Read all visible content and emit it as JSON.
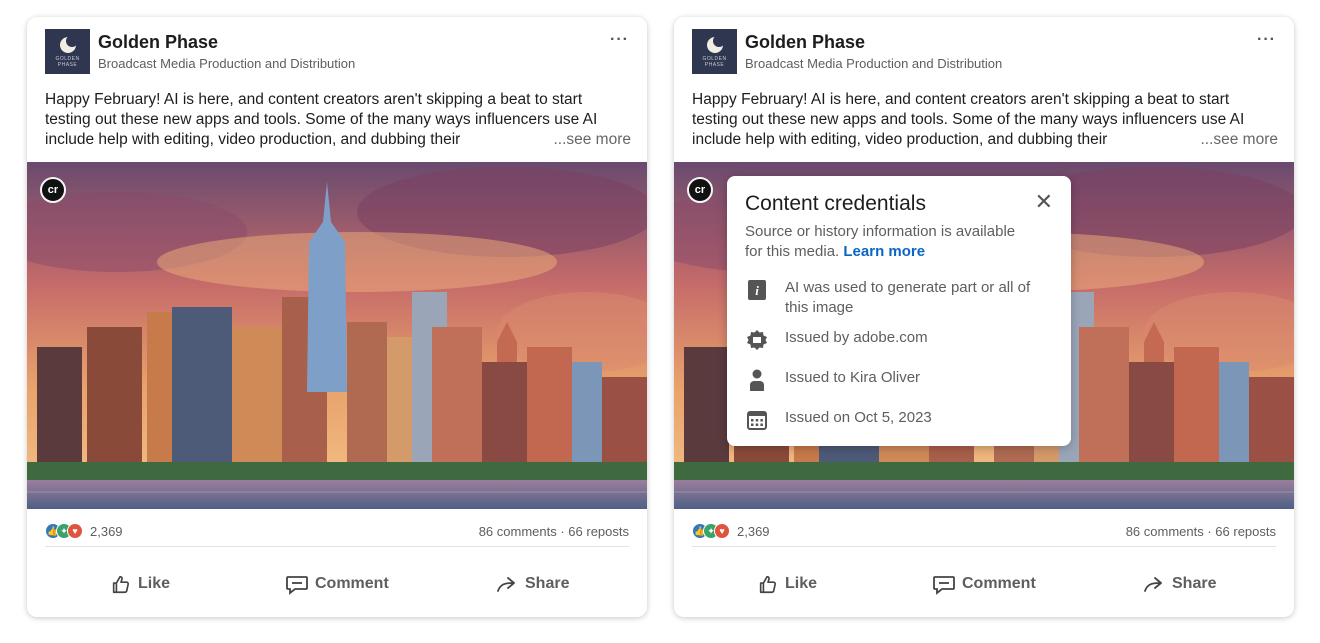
{
  "post": {
    "page_name": "Golden Phase",
    "logo_text": "GOLDEN PHASE",
    "subtitle": "Broadcast Media Production and Distribution",
    "text_lines": [
      "Happy February! AI is here, and content creators aren't skipping a beat to start",
      "testing out these new apps and tools. Some of the many ways influencers use AI",
      "include help with editing, video production, and dubbing their"
    ],
    "see_more": "...see more",
    "more_menu": "···",
    "cr_badge": "cr",
    "reaction_count": "2,369",
    "comments_reposts": "86 comments · 66 reposts",
    "actions": {
      "like": "Like",
      "comment": "Comment",
      "share": "Share"
    }
  },
  "credentials": {
    "title": "Content credentials",
    "close": "✕",
    "description": "Source or history information is available for this media.",
    "learn_more": "Learn more",
    "items": [
      {
        "icon": "info-icon",
        "text": "AI was used to generate part or all of this image"
      },
      {
        "icon": "badge-icon",
        "text": "Issued by adobe.com"
      },
      {
        "icon": "person-icon",
        "text": "Issued to Kira Oliver"
      },
      {
        "icon": "calendar-icon",
        "text": "Issued on Oct 5, 2023"
      }
    ]
  },
  "colors": {
    "brand_logo_bg": "#2f3650",
    "link": "#0a66c2",
    "like": "#2f78c4",
    "celebrate": "#3aa26a",
    "love": "#e0533c"
  }
}
